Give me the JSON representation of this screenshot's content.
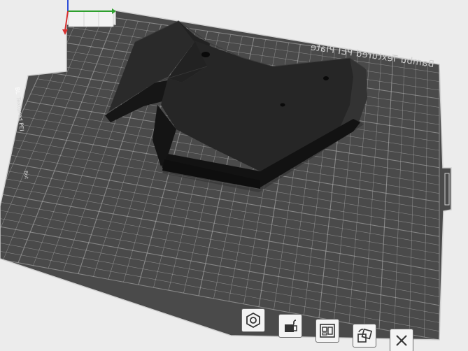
{
  "plate": {
    "name": "Bambu Textured PEI Plate",
    "side_label": "Textured PEI",
    "side_badge": "BL",
    "side_extra": "Bot",
    "bed_color": "#4a4a4a",
    "grid_color": "#b8b8b8",
    "model_color": "#1c1c1c"
  },
  "toolbar": {
    "buttons": [
      {
        "name": "slice-plate-button",
        "icon": "hex-nut-icon"
      },
      {
        "name": "lock-plate-button",
        "icon": "lock-icon"
      },
      {
        "name": "arrange-button",
        "icon": "arrange-icon"
      },
      {
        "name": "auto-orient-button",
        "icon": "rotate-icon"
      },
      {
        "name": "delete-plate-button",
        "icon": "close-icon"
      }
    ]
  },
  "axes": {
    "x_color": "#d83030",
    "y_color": "#2ea02e",
    "z_color": "#2f4fd8"
  }
}
